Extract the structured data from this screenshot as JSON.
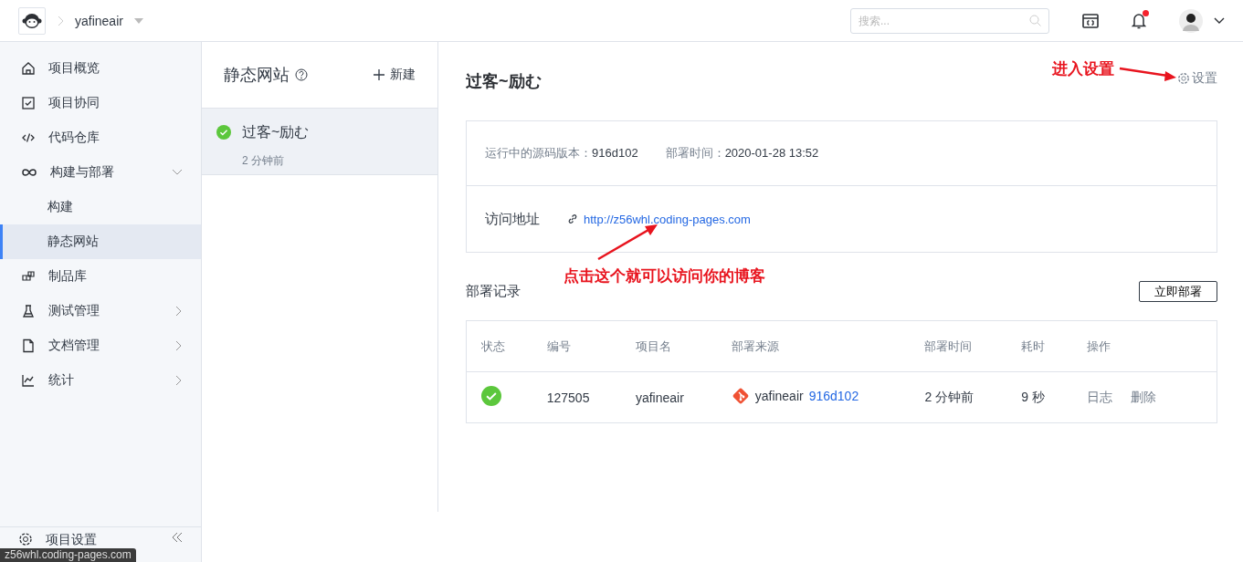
{
  "topbar": {
    "project": "yafineair",
    "search": {
      "placeholder": "搜索..."
    },
    "notifications": {
      "unread": true
    }
  },
  "sidebar": {
    "items": [
      {
        "label": "项目概览",
        "selected": false
      },
      {
        "label": "项目协同",
        "selected": false
      },
      {
        "label": "代码仓库",
        "selected": false
      },
      {
        "label": "构建与部署",
        "selected": false,
        "expanded": true,
        "children": [
          {
            "label": "构建",
            "selected": false
          },
          {
            "label": "静态网站",
            "selected": true
          }
        ]
      },
      {
        "label": "制品库",
        "selected": false
      },
      {
        "label": "测试管理",
        "selected": false,
        "expanded": false
      },
      {
        "label": "文档管理",
        "selected": false,
        "expanded": false
      },
      {
        "label": "统计",
        "selected": false,
        "expanded": false
      }
    ],
    "footer": {
      "label": "项目设置"
    }
  },
  "sites_panel": {
    "title": "静态网站",
    "new_button": "新建",
    "sites": [
      {
        "name": "过客~励む",
        "time": "2 分钟前",
        "succeeded": true,
        "selected": true
      }
    ]
  },
  "detail": {
    "title": "过客~励む",
    "settings": "设置",
    "info": [
      {
        "label": "运行中的源码版本：",
        "value": "916d102"
      },
      {
        "label": "部署时间：",
        "value": "2020-01-28 13:52"
      }
    ],
    "address": {
      "label": "访问地址",
      "url": "http://z56whl.coding-pages.com"
    },
    "records_title": "部署记录",
    "deploy_button": "立即部署",
    "table": {
      "columns": [
        "状态",
        "编号",
        "项目名",
        "部署来源",
        "部署时间",
        "耗时",
        "操作"
      ],
      "rows": [
        {
          "succeeded": true,
          "number": "127505",
          "project": "yafineair",
          "source": {
            "repo": "yafineair",
            "commit": "916d102"
          },
          "time": "2 分钟前",
          "duration": "9 秒",
          "actions": [
            "日志",
            "删除"
          ]
        }
      ]
    }
  },
  "annotations": [
    {
      "text": "进入设置"
    },
    {
      "text": "点击这个就可以访问你的博客"
    }
  ],
  "status_bar": "z56whl.coding-pages.com"
}
